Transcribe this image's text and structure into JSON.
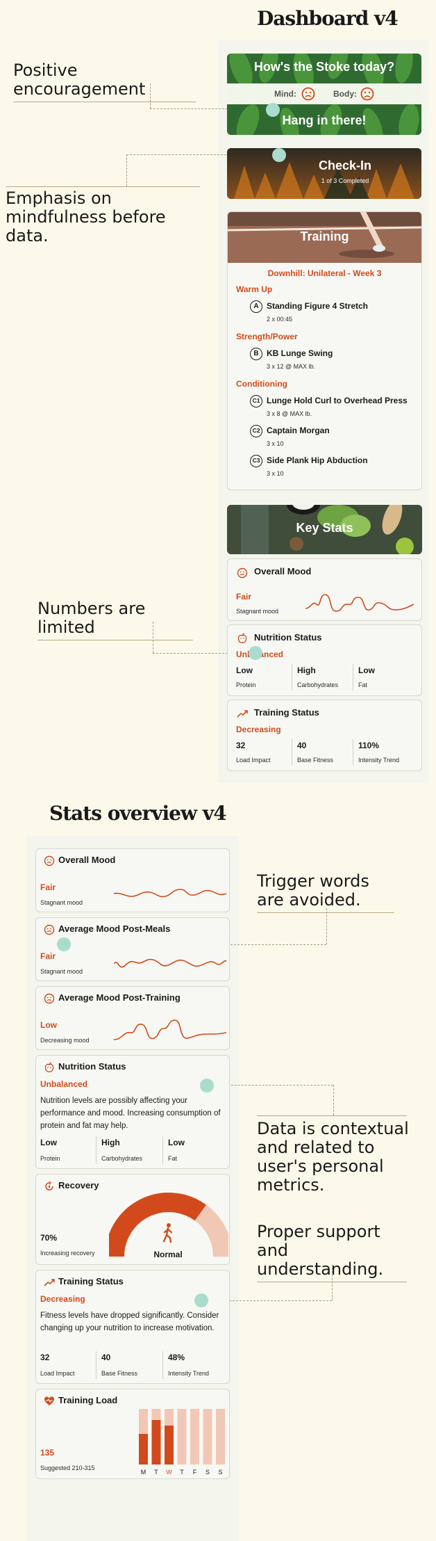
{
  "dashboard": {
    "title": "Dashboard v4",
    "stoke": {
      "question": "How's the Stoke today?",
      "mind_label": "Mind:",
      "body_label": "Body:",
      "message": "Hang in there!"
    },
    "checkin": {
      "title": "Check-In",
      "sub": "1 of 3 Completed"
    },
    "training": {
      "title": "Training",
      "program": "Downhill: Unilateral - Week 3",
      "sections": [
        {
          "name": "Warm Up",
          "items": [
            {
              "badge": "A",
              "name": "Standing Figure 4 Stretch",
              "detail": "2 x 00:45"
            }
          ]
        },
        {
          "name": "Strength/Power",
          "items": [
            {
              "badge": "B",
              "name": "KB Lunge Swing",
              "detail": "3 x 12 @ MAX lb."
            }
          ]
        },
        {
          "name": "Conditioning",
          "items": [
            {
              "badge": "C1",
              "name": "Lunge Hold Curl to Overhead Press",
              "detail": "3 x 8 @ MAX lb."
            },
            {
              "badge": "C2",
              "name": "Captain Morgan",
              "detail": "3 x 10"
            },
            {
              "badge": "C3",
              "name": "Side Plank Hip Abduction",
              "detail": "3 x 10"
            }
          ]
        }
      ]
    },
    "keystats": {
      "title": "Key Stats"
    },
    "mood": {
      "title": "Overall Mood",
      "value": "Fair",
      "sub": "Stagnant mood"
    },
    "nutrition": {
      "title": "Nutrition Status",
      "value": "Unbalanced",
      "metrics": [
        {
          "value": "Low",
          "label": "Protein"
        },
        {
          "value": "High",
          "label": "Carbohydrates"
        },
        {
          "value": "Low",
          "label": "Fat"
        }
      ]
    },
    "training_status": {
      "title": "Training Status",
      "value": "Decreasing",
      "metrics": [
        {
          "value": "32",
          "label": "Load Impact"
        },
        {
          "value": "40",
          "label": "Base Fitness"
        },
        {
          "value": "110%",
          "label": "Intensity Trend"
        }
      ]
    }
  },
  "notes": {
    "positive": "Positive encouragement",
    "mindful": "Emphasis on mindfulness before data.",
    "numbers": "Numbers are limited",
    "trigger": "Trigger words are avoided.",
    "contextual": "Data is contextual and related to user's personal metrics.",
    "support": "Proper support and understanding."
  },
  "stats": {
    "title": "Stats overview v4",
    "mood": {
      "title": "Overall Mood",
      "value": "Fair",
      "sub": "Stagnant mood"
    },
    "meals": {
      "title": "Average Mood Post-Meals",
      "value": "Fair",
      "sub": "Stagnant mood"
    },
    "post_training": {
      "title": "Average Mood Post-Training",
      "value": "Low",
      "sub": "Decreasing mood"
    },
    "nutrition": {
      "title": "Nutrition Status",
      "value": "Unbalanced",
      "desc": "Nutrition levels are possibly affecting your performance and mood. Increasing consumption of protein and fat may help.",
      "metrics": [
        {
          "value": "Low",
          "label": "Protein"
        },
        {
          "value": "High",
          "label": "Carbohydrates"
        },
        {
          "value": "Low",
          "label": "Fat"
        }
      ]
    },
    "recovery": {
      "title": "Recovery",
      "value": "70%",
      "sub": "Increasing recovery",
      "gauge_label": "Normal",
      "level": 0.7
    },
    "training_status": {
      "title": "Training Status",
      "value": "Decreasing",
      "desc": "Fitness levels have dropped significantly. Consider changing up your nutrition to increase motivation.",
      "metrics": [
        {
          "value": "32",
          "label": "Load Impact"
        },
        {
          "value": "40",
          "label": "Base Fitness"
        },
        {
          "value": "48%",
          "label": "Intensity Trend"
        }
      ]
    },
    "load": {
      "title": "Training Load",
      "value": "135",
      "sub": "Suggested 210-315",
      "days": [
        "M",
        "T",
        "W",
        "T",
        "F",
        "S",
        "S"
      ],
      "levels": [
        0.55,
        0.8,
        0.7,
        0,
        0,
        0,
        0
      ]
    }
  },
  "colors": {
    "accent": "#d24a1c",
    "dot": "#a9dccd",
    "bg": "#fdf9ea"
  }
}
